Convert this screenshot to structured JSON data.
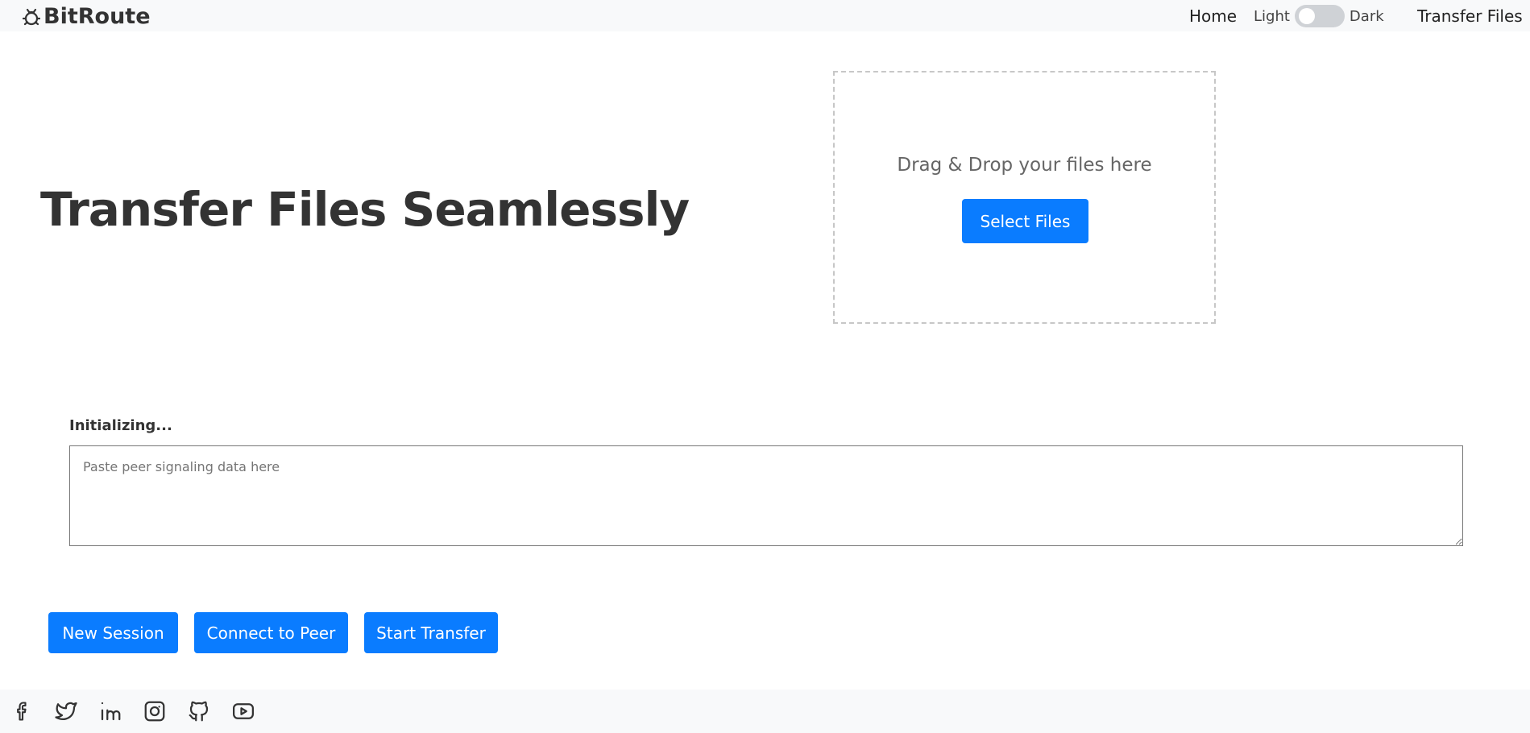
{
  "navbar": {
    "brand": "BitRoute",
    "brand_icon": "bug-icon",
    "home_label": "Home",
    "theme_light_label": "Light",
    "theme_dark_label": "Dark",
    "theme_mode": "light",
    "transfer_label": "Transfer Files"
  },
  "hero": {
    "title": "Transfer Files Seamlessly"
  },
  "dropzone": {
    "text": "Drag & Drop your files here",
    "button_label": "Select Files"
  },
  "session": {
    "status": "Initializing...",
    "signal_placeholder": "Paste peer signaling data here",
    "signal_value": ""
  },
  "actions": {
    "new_session_label": "New Session",
    "connect_label": "Connect to Peer",
    "start_label": "Start Transfer"
  },
  "footer": {
    "social_icons": [
      "facebook-icon",
      "twitter-icon",
      "linkedin-icon",
      "instagram-icon",
      "github-icon",
      "youtube-icon"
    ]
  },
  "colors": {
    "primary": "#0a7cff",
    "navbar_bg": "#f8f9fa",
    "heading": "#333333"
  }
}
